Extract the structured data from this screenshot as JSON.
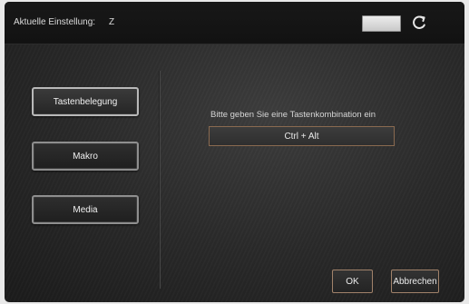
{
  "header": {
    "current_setting_label": "Aktuelle Einstellung:",
    "current_setting_value": "Z",
    "refresh_icon": "refresh-icon"
  },
  "nav": {
    "items": [
      {
        "label": "Tastenbelegung",
        "active": true
      },
      {
        "label": "Makro",
        "active": false
      },
      {
        "label": "Media",
        "active": false
      }
    ]
  },
  "main": {
    "prompt": "Bitte geben Sie eine Tastenkombination ein",
    "key_combination": "Ctrl + Alt"
  },
  "actions": {
    "ok_label": "OK",
    "cancel_label": "Abbrechen"
  },
  "colors": {
    "accent_border": "#a1826a",
    "header_bg": "#151515",
    "panel_bg": "#2a2a2a"
  }
}
